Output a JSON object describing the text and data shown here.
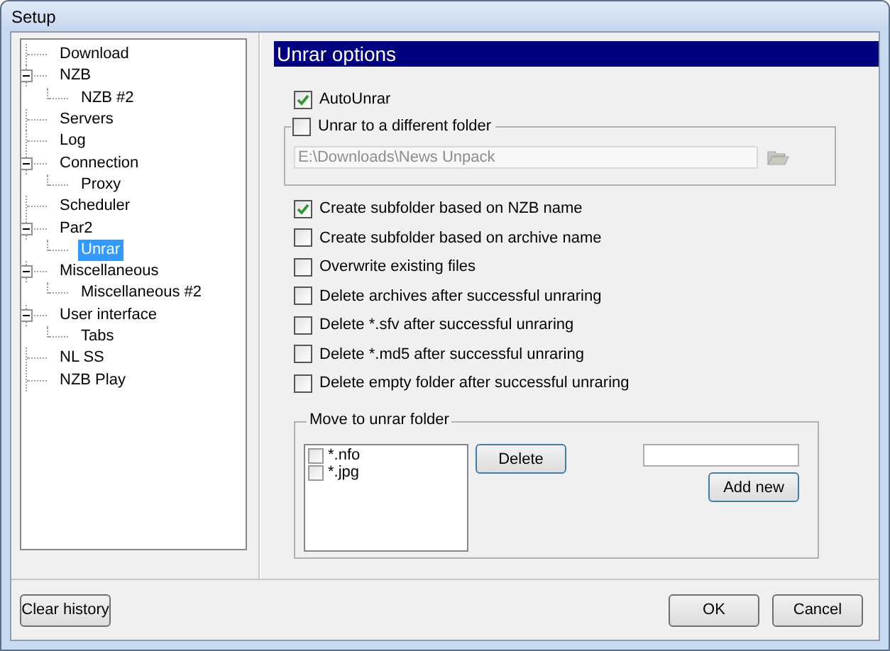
{
  "window": {
    "title": "Setup"
  },
  "tree": [
    {
      "label": "Download",
      "selected": false
    },
    {
      "label": "NZB",
      "selected": false,
      "expanded": true,
      "children": [
        {
          "label": "NZB #2",
          "selected": false
        }
      ]
    },
    {
      "label": "Servers",
      "selected": false
    },
    {
      "label": "Log",
      "selected": false
    },
    {
      "label": "Connection",
      "selected": false,
      "expanded": true,
      "children": [
        {
          "label": "Proxy",
          "selected": false
        }
      ]
    },
    {
      "label": "Scheduler",
      "selected": false
    },
    {
      "label": "Par2",
      "selected": false,
      "expanded": true,
      "children": [
        {
          "label": "Unrar",
          "selected": true
        }
      ]
    },
    {
      "label": "Miscellaneous",
      "selected": false,
      "expanded": true,
      "children": [
        {
          "label": "Miscellaneous #2",
          "selected": false
        }
      ]
    },
    {
      "label": "User interface",
      "selected": false,
      "expanded": true,
      "children": [
        {
          "label": "Tabs",
          "selected": false
        }
      ]
    },
    {
      "label": "NL SS",
      "selected": false
    },
    {
      "label": "NZB Play",
      "selected": false
    }
  ],
  "panel": {
    "title": "Unrar options",
    "auto_unrar": {
      "label": "AutoUnrar",
      "checked": true
    },
    "folder_group": {
      "label": "Unrar to a different folder",
      "checked": false,
      "path": "E:\\Downloads\\News Unpack",
      "disabled": true
    },
    "options": [
      {
        "label": "Create subfolder based on NZB name",
        "checked": true
      },
      {
        "label": "Create subfolder based on archive name",
        "checked": false
      },
      {
        "label": "Overwrite existing files",
        "checked": false
      },
      {
        "label": "Delete archives after successful unraring",
        "checked": false
      },
      {
        "label": "Delete *.sfv after successful unraring",
        "checked": false
      },
      {
        "label": "Delete *.md5 after successful unraring",
        "checked": false
      },
      {
        "label": "Delete empty folder after successful unraring",
        "checked": false
      }
    ],
    "move_group": {
      "title": "Move to unrar folder",
      "items": [
        {
          "label": "*.nfo",
          "checked": false
        },
        {
          "label": "*.jpg",
          "checked": false
        }
      ],
      "delete_button": "Delete",
      "add_button": "Add new"
    }
  },
  "footer": {
    "clear_history": "Clear history",
    "ok": "OK",
    "cancel": "Cancel"
  }
}
